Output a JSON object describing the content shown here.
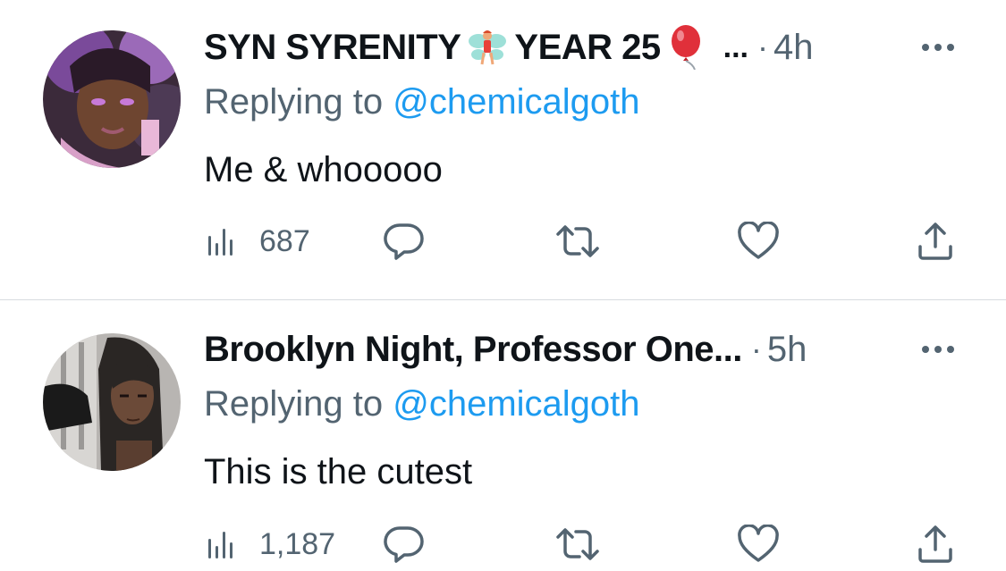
{
  "tweets": [
    {
      "name_part1": "SYN SYRENITY",
      "name_part2": "YEAR 25",
      "ellipsis": "...",
      "time": "4h",
      "replying_prefix": "Replying to ",
      "replying_handle": "@chemicalgoth",
      "text": "Me & whooooo",
      "views": "687",
      "emoji_icons": [
        "fairy-emoji-icon",
        "balloon-emoji-icon"
      ]
    },
    {
      "name": "Brooklyn Night, Professor One...",
      "time": "5h",
      "replying_prefix": "Replying to ",
      "replying_handle": "@chemicalgoth",
      "text": "This is the cutest",
      "views": "1,187"
    }
  ],
  "colors": {
    "text": "#0f1419",
    "secondary": "#536471",
    "link": "#1d9bf0",
    "divider": "#d7dbdf"
  },
  "separator": "·"
}
